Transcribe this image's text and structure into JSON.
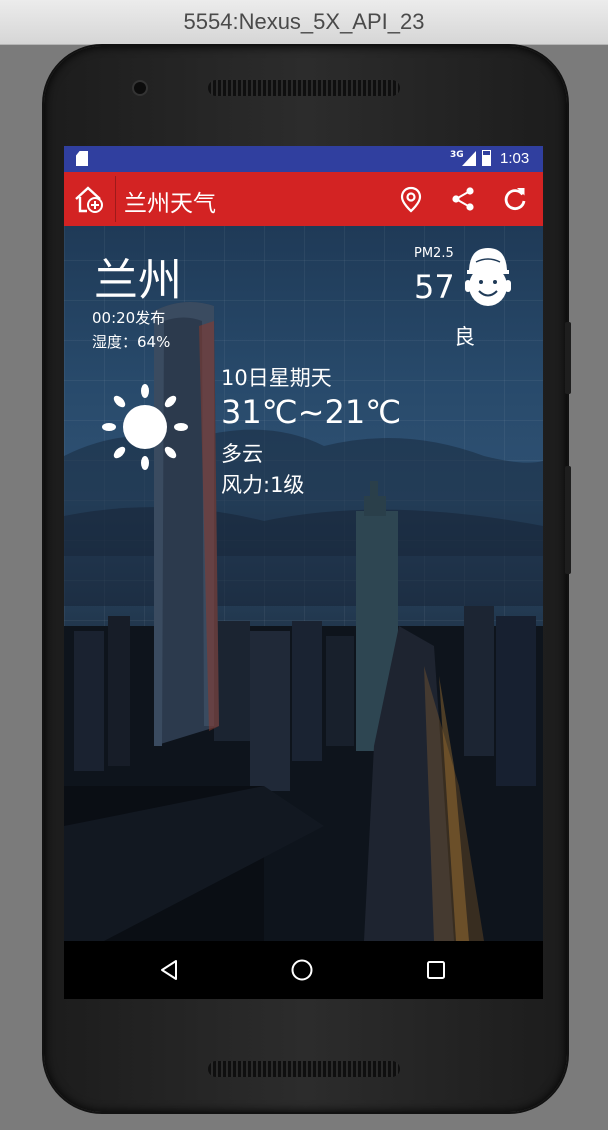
{
  "window": {
    "title": "5554:Nexus_5X_API_23"
  },
  "status_bar": {
    "network": "3G",
    "time": "1:03"
  },
  "toolbar": {
    "title": "兰州天气",
    "icons": [
      "home-add-icon",
      "location-pin-icon",
      "share-icon",
      "refresh-icon"
    ]
  },
  "weather": {
    "city": "兰州",
    "publish_time": "00:20发布",
    "humidity": "湿度：64%",
    "pm25_label": "PM2.5",
    "pm25_value": "57",
    "air_quality": "良",
    "date": "10日星期天",
    "temperature": "31℃~21℃",
    "condition": "多云",
    "wind": "风力:1级",
    "icons": [
      "sun-icon",
      "smiley-face-icon"
    ]
  },
  "navbar": {
    "icons": [
      "back-icon",
      "home-icon",
      "recents-icon"
    ]
  },
  "colors": {
    "status_bar": "#303f9f",
    "toolbar": "#d32323",
    "text": "#ffffff"
  }
}
